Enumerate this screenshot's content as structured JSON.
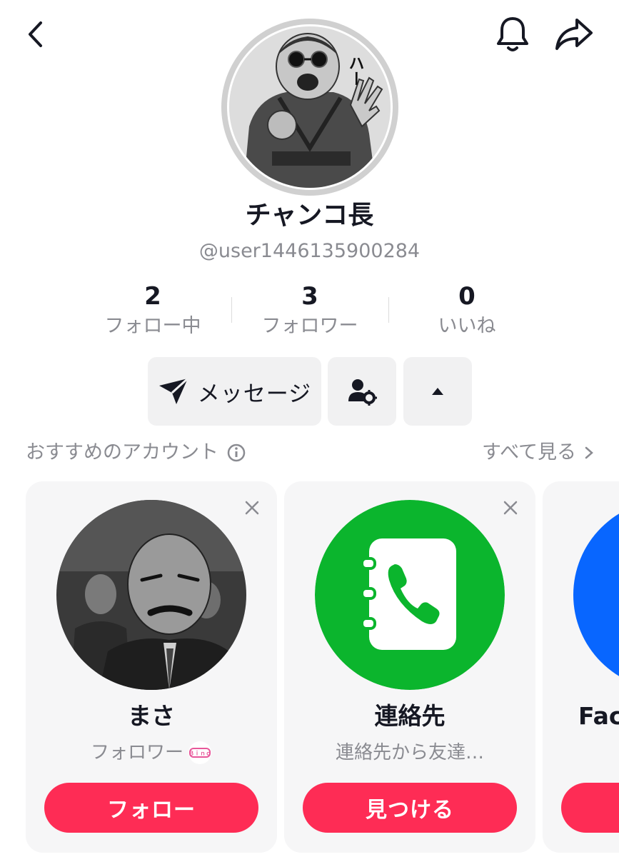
{
  "header": {
    "back_icon": "chevron-left-icon",
    "bell_icon": "bell-icon",
    "share_icon": "share-arrow-icon"
  },
  "profile": {
    "display_name": "チャンコ長",
    "username": "@user1446135900284",
    "avatar_caption": "ハー"
  },
  "stats": [
    {
      "value": "2",
      "label": "フォロー中"
    },
    {
      "value": "3",
      "label": "フォロワー"
    },
    {
      "value": "0",
      "label": "いいね"
    }
  ],
  "actions": {
    "message_label": "メッセージ",
    "message_icon": "send-icon",
    "person_icon": "person-gear-icon",
    "more_icon": "caret-up-icon"
  },
  "suggestions": {
    "title": "おすすめのアカウント",
    "see_all": "すべて見る",
    "cards": [
      {
        "name": "まさ",
        "subtitle": "フォロワー",
        "button": "フォロー",
        "badge_text": "Ｂｉｎｄ"
      },
      {
        "name": "連絡先",
        "subtitle": "連絡先から友達…",
        "button": "見つける"
      },
      {
        "name": "Face",
        "subtitle": "",
        "button": ""
      }
    ]
  },
  "colors": {
    "accent": "#fe2c55",
    "contacts_green": "#0bb52d",
    "facebook_blue": "#0866ff",
    "muted_text": "#8a8b91",
    "button_bg": "#f1f1f2"
  }
}
